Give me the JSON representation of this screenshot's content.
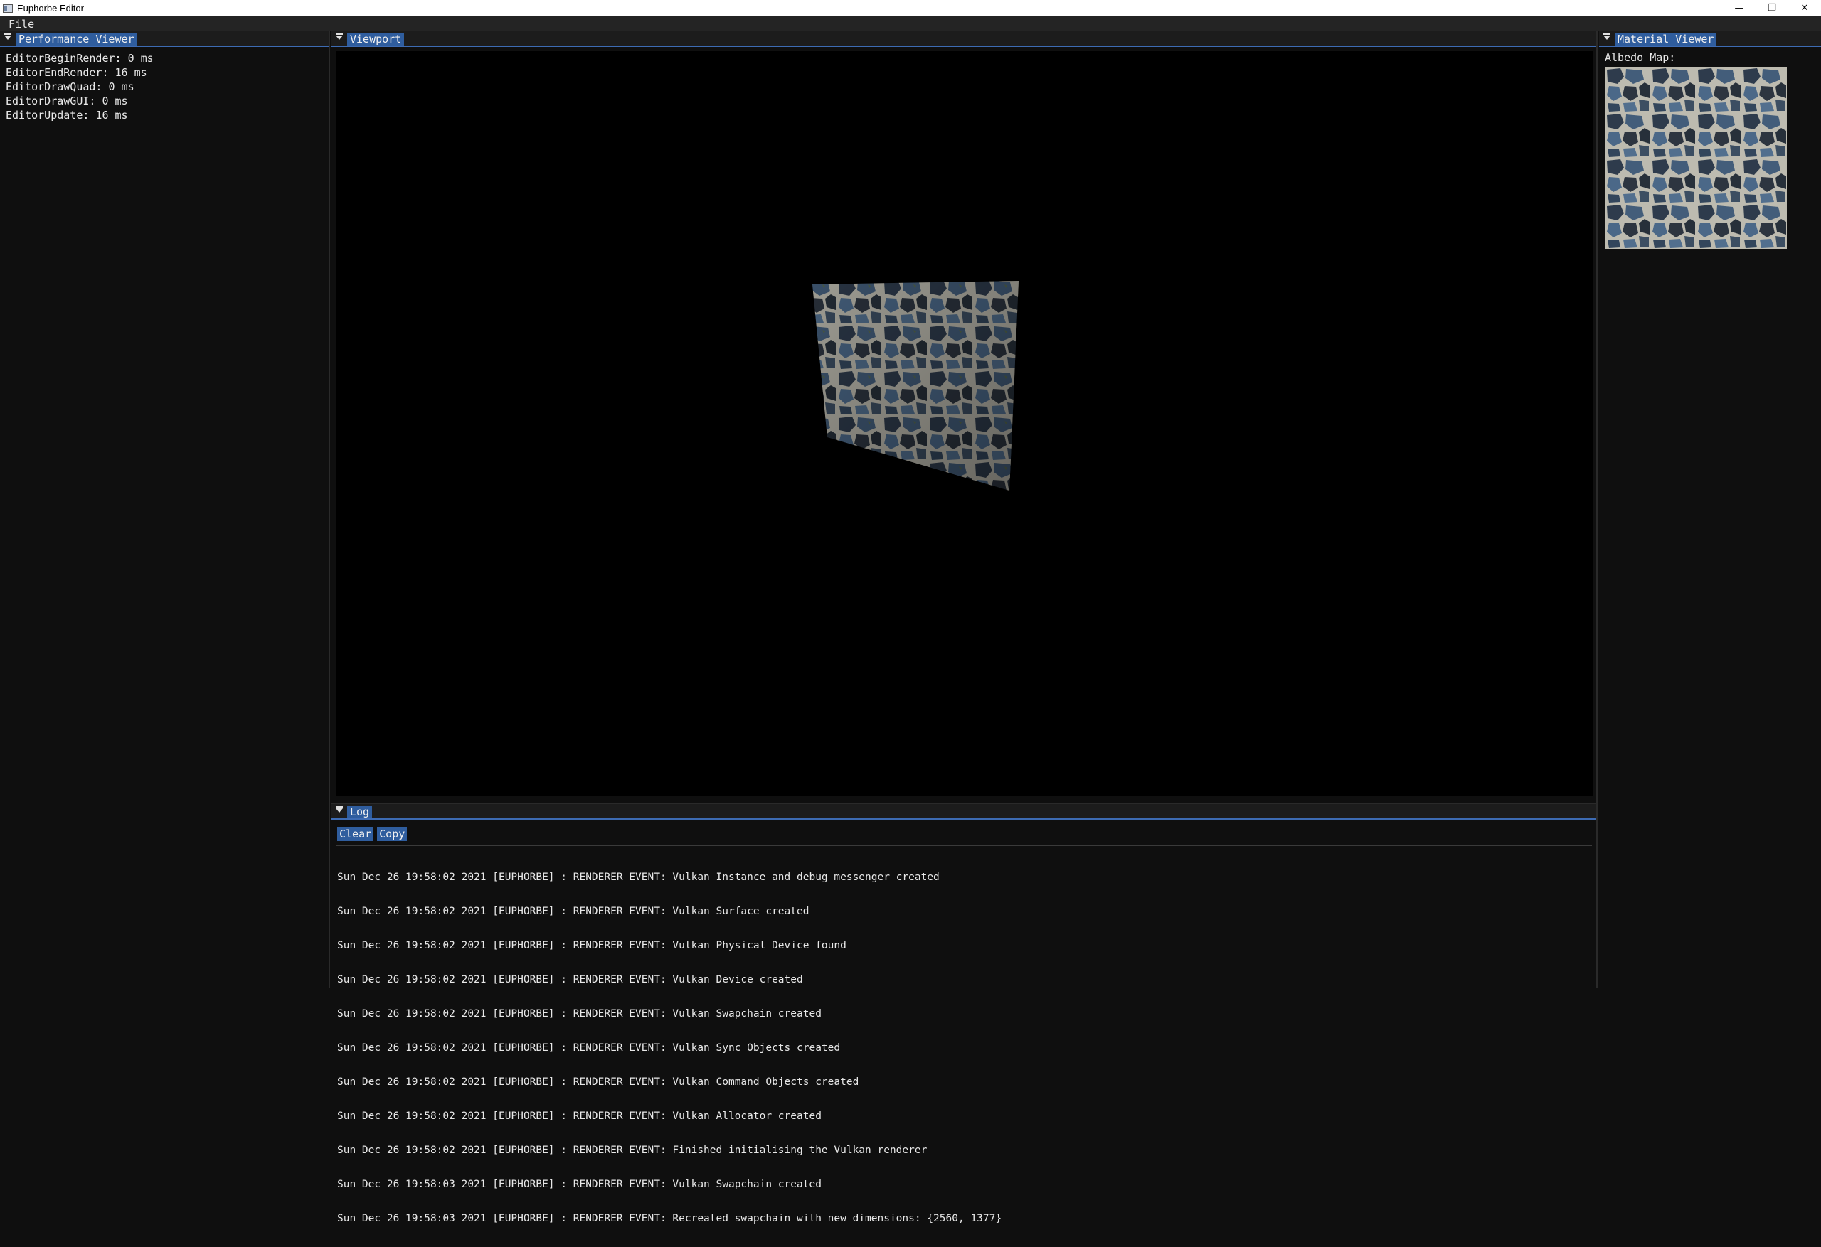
{
  "window": {
    "title": "Euphorbe Editor",
    "controls": {
      "minimize": "—",
      "restore": "❐",
      "close": "✕"
    }
  },
  "menubar": {
    "items": [
      "File"
    ]
  },
  "performance_viewer": {
    "tab_label": "Performance Viewer",
    "entries": [
      "EditorBeginRender: 0 ms",
      "EditorEndRender: 16 ms",
      "EditorDrawQuad: 0 ms",
      "EditorDrawGUI: 0 ms",
      "EditorUpdate: 16 ms"
    ]
  },
  "viewport": {
    "tab_label": "Viewport"
  },
  "log": {
    "tab_label": "Log",
    "clear_label": "Clear",
    "copy_label": "Copy",
    "lines": [
      "Sun Dec 26 19:58:02 2021 [EUPHORBE] : RENDERER EVENT: Vulkan Instance and debug messenger created",
      "Sun Dec 26 19:58:02 2021 [EUPHORBE] : RENDERER EVENT: Vulkan Surface created",
      "Sun Dec 26 19:58:02 2021 [EUPHORBE] : RENDERER EVENT: Vulkan Physical Device found",
      "Sun Dec 26 19:58:02 2021 [EUPHORBE] : RENDERER EVENT: Vulkan Device created",
      "Sun Dec 26 19:58:02 2021 [EUPHORBE] : RENDERER EVENT: Vulkan Swapchain created",
      "Sun Dec 26 19:58:02 2021 [EUPHORBE] : RENDERER EVENT: Vulkan Sync Objects created",
      "Sun Dec 26 19:58:02 2021 [EUPHORBE] : RENDERER EVENT: Vulkan Command Objects created",
      "Sun Dec 26 19:58:02 2021 [EUPHORBE] : RENDERER EVENT: Vulkan Allocator created",
      "Sun Dec 26 19:58:02 2021 [EUPHORBE] : RENDERER EVENT: Finished initialising the Vulkan renderer",
      "Sun Dec 26 19:58:03 2021 [EUPHORBE] : RENDERER EVENT: Vulkan Swapchain created",
      "Sun Dec 26 19:58:03 2021 [EUPHORBE] : RENDERER EVENT: Recreated swapchain with new dimensions: {2560, 1377}"
    ]
  },
  "material_viewer": {
    "tab_label": "Material Viewer",
    "albedo_label": "Albedo Map:"
  },
  "colors": {
    "accent": "#2f5d9e",
    "panel_bg": "#0f0f0f",
    "viewport_bg": "#000000"
  }
}
